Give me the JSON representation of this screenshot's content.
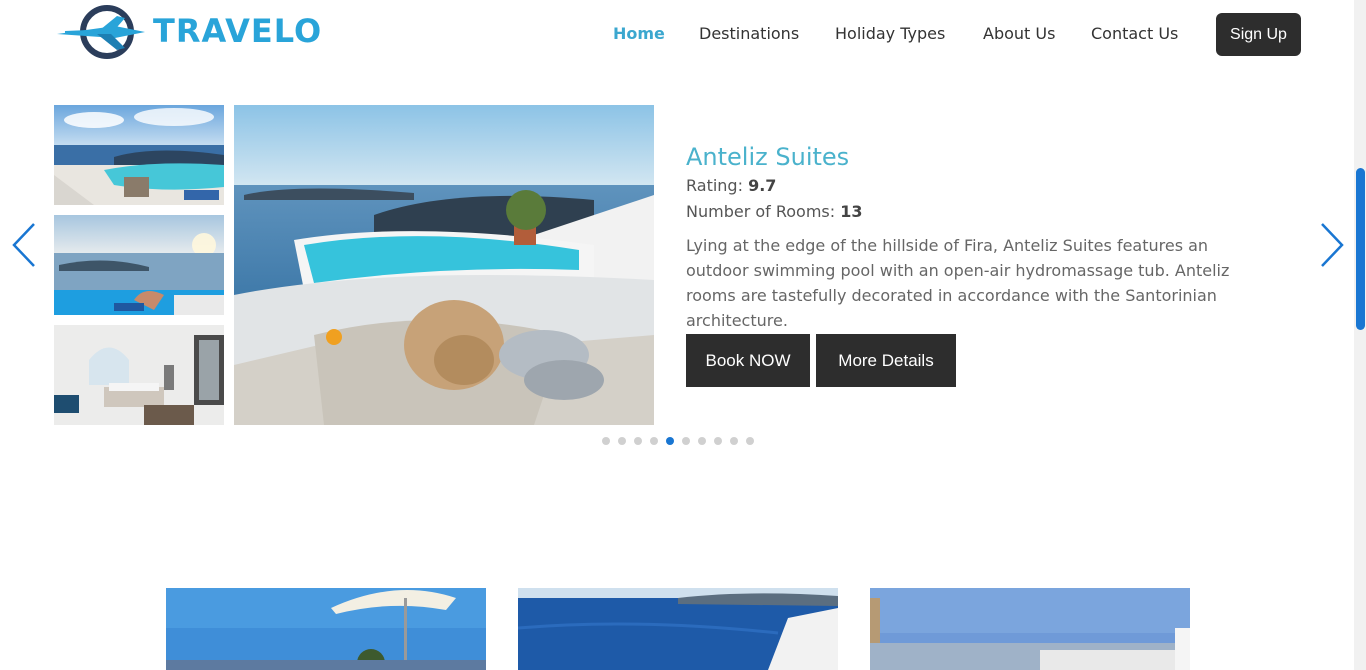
{
  "brand": {
    "name": "TRAVELO",
    "color": "#29a4d9"
  },
  "nav": {
    "items": [
      {
        "label": "Home",
        "active": true
      },
      {
        "label": "Destinations"
      },
      {
        "label": "Holiday Types"
      },
      {
        "label": "About Us"
      },
      {
        "label": "Contact Us"
      }
    ],
    "signup_label": "Sign Up"
  },
  "hotel": {
    "name": "Anteliz Suites",
    "rating_label": "Rating:",
    "rating": "9.7",
    "rooms_label": "Number of Rooms:",
    "rooms": "13",
    "description": "Lying at the edge of the hillside of Fira, Anteliz Suites features an outdoor swimming pool with an open-air hydromassage tub. Anteliz rooms are tastefully decorated in accordance with the Santorinian architecture.",
    "book_label": "Book NOW",
    "details_label": "More Details"
  },
  "carousel": {
    "slide_count": 10,
    "active_index": 4,
    "prev_icon": "chevron-left-icon",
    "next_icon": "chevron-right-icon"
  },
  "colors": {
    "accent": "#3ba7cf",
    "dark_button": "#2d2d2d",
    "active_dot": "#1976d2"
  }
}
